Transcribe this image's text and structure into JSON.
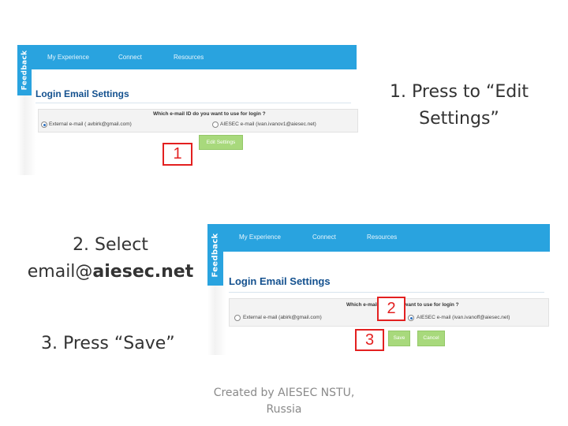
{
  "captions": {
    "step1_line1": "1. Press to “Edit",
    "step1_line2": "Settings”",
    "step2_line1": "2. Select",
    "step2_line2_prefix": "email@",
    "step2_line2_bold": "aiesec.net",
    "step3": "3. Press “Save”"
  },
  "markers": {
    "m1": "1",
    "m2": "2",
    "m3": "3"
  },
  "screenshot1": {
    "feedback_tab": "Feedback",
    "nav": [
      "My Experience",
      "Connect",
      "Resources"
    ],
    "page_title": "Login Email Settings",
    "question": "Which e-mail ID do you want to use for login ?",
    "option_external": "External e-mail ( avbirk@gmail.com)",
    "option_aiesec": "AIESEC e-mail (ivan.ivanov1@aiesec.net)",
    "selected": "external",
    "edit_button": "Edit Settings"
  },
  "screenshot2": {
    "feedback_tab": "Feedback",
    "nav": [
      "My Experience",
      "Connect",
      "Resources"
    ],
    "page_title": "Login Email Settings",
    "question": "Which e-mail ID do you want to use for login ?",
    "option_external": "External e-mail (abirk@gmail.com)",
    "option_aiesec": "AIESEC e-mail (ivan.ivanoff@aiesec.net)",
    "selected": "aiesec",
    "save_button": "Save",
    "cancel_button": "Cancel"
  },
  "footer": {
    "line1": "Created by AIESEC NSTU,",
    "line2": "Russia"
  },
  "colors": {
    "nav_blue": "#29a3df",
    "title_blue": "#14518f",
    "button_green": "#a8d97c",
    "marker_red": "#e32020"
  }
}
